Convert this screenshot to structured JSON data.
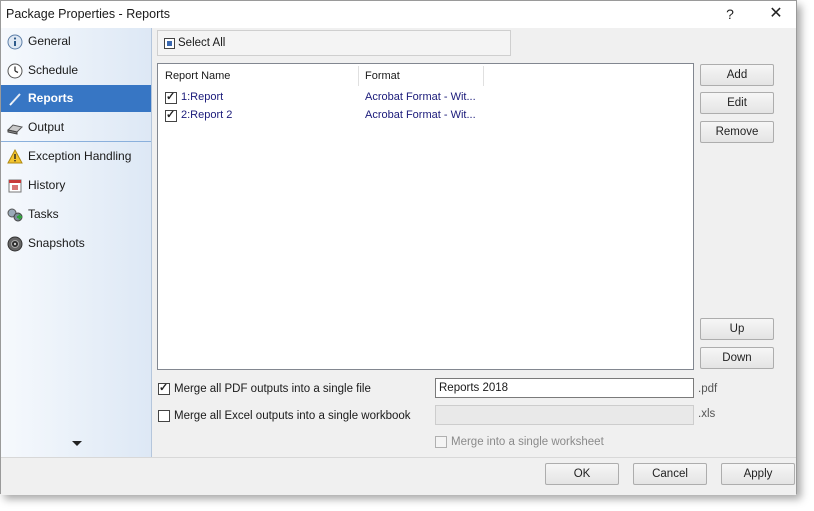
{
  "window": {
    "title": "Package Properties - Reports",
    "help_label": "?",
    "close_label": "✕"
  },
  "sidebar": {
    "items": [
      {
        "label": "General",
        "icon": "info-icon"
      },
      {
        "label": "Schedule",
        "icon": "clock-icon"
      },
      {
        "label": "Reports",
        "icon": "pen-icon",
        "active": true
      },
      {
        "label": "Output",
        "icon": "printer-icon"
      },
      {
        "label": "Exception Handling",
        "icon": "warning-icon"
      },
      {
        "label": "History",
        "icon": "calendar-icon"
      },
      {
        "label": "Tasks",
        "icon": "tasks-icon"
      },
      {
        "label": "Snapshots",
        "icon": "camera-icon"
      }
    ]
  },
  "reports": {
    "select_all_label": "Select All",
    "columns": [
      "Report Name",
      "Format"
    ],
    "rows": [
      {
        "name": "1:Report",
        "format": "Acrobat Format - Wit...",
        "checked": true
      },
      {
        "name": "2:Report 2",
        "format": "Acrobat Format - Wit...",
        "checked": true
      }
    ]
  },
  "buttons": {
    "add": "Add",
    "edit": "Edit",
    "remove": "Remove",
    "up": "Up",
    "down": "Down"
  },
  "merge": {
    "pdf_label": "Merge all PDF outputs into a single file",
    "pdf_checked": true,
    "pdf_value": "Reports 2018",
    "pdf_ext": ".pdf",
    "excel_label": "Merge all Excel outputs into a single workbook",
    "excel_checked": false,
    "excel_value": "",
    "excel_ext": ".xls",
    "worksheet_label": "Merge into a single worksheet",
    "worksheet_checked": false
  },
  "footer": {
    "ok": "OK",
    "cancel": "Cancel",
    "apply": "Apply"
  },
  "colors": {
    "accent": "#3776c4",
    "link_text": "#1a1a7a"
  }
}
